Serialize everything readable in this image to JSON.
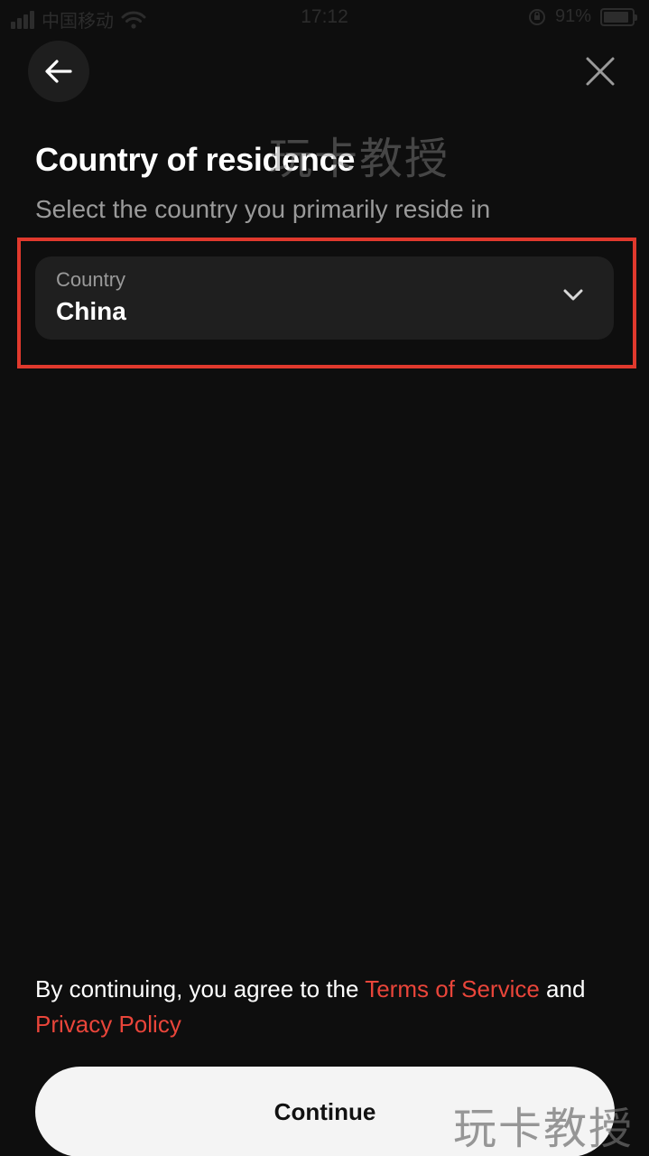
{
  "status_bar": {
    "carrier": "中国移动",
    "time": "17:12",
    "battery_percent": "91%",
    "battery_level": 0.91
  },
  "nav": {
    "back_icon": "arrow-left-icon",
    "close_icon": "close-icon"
  },
  "header": {
    "title": "Country of residence",
    "subtitle": "Select the country you primarily reside in"
  },
  "country_field": {
    "label": "Country",
    "value": "China",
    "icon": "chevron-down-icon"
  },
  "legal": {
    "prefix": "By continuing, you agree to the ",
    "terms_link": "Terms of Service",
    "middle": " and",
    "privacy_link": "Privacy Policy"
  },
  "footer": {
    "continue_label": "Continue"
  },
  "watermark": {
    "text": "玩卡教授"
  },
  "colors": {
    "background": "#0e0e0e",
    "field": "#1f1f1f",
    "link": "#e9453a",
    "highlight": "#e0392d",
    "button": "#f4f4f4"
  }
}
